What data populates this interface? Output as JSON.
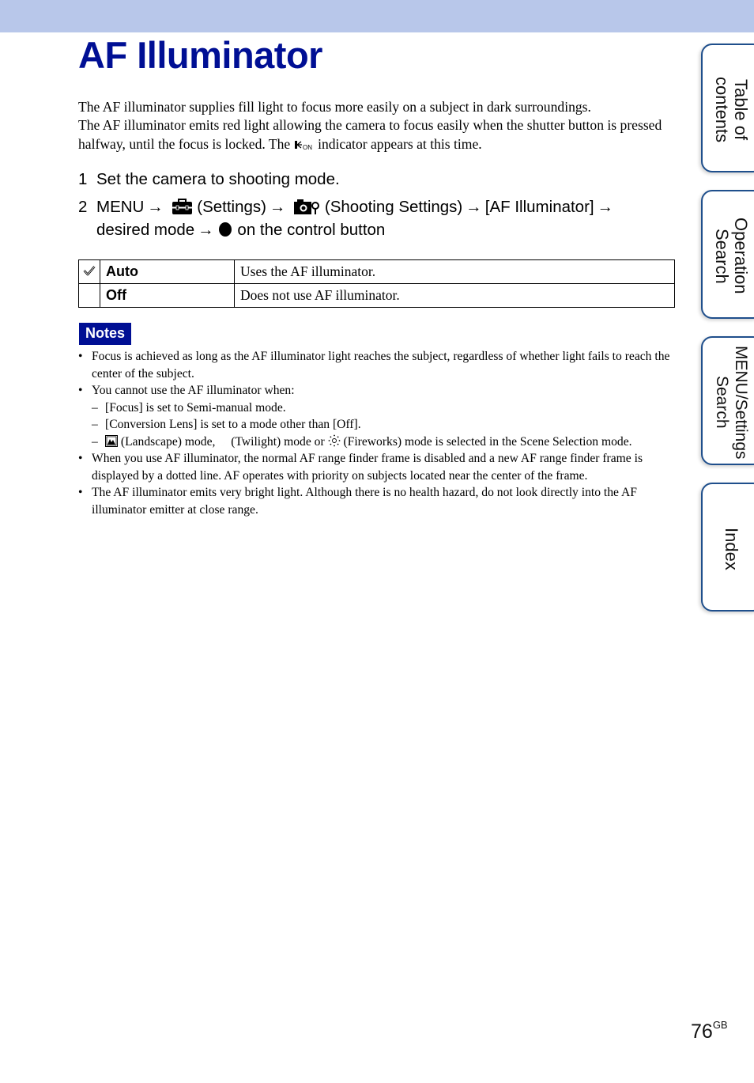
{
  "header": {
    "title": "AF Illuminator"
  },
  "intro": {
    "line1": "The AF illuminator supplies fill light to focus more easily on a subject in dark surroundings.",
    "line2_before_icon": "The AF illuminator emits red light allowing the camera to focus easily when the shutter button is pressed halfway, until the focus is locked. The",
    "indicator_icon": "af-illuminator-on-indicator-icon",
    "line2_after_icon": "indicator appears at this time."
  },
  "steps": [
    {
      "number": "1",
      "text": "Set the camera to shooting mode."
    },
    {
      "number": "2",
      "parts": {
        "menu": "MENU",
        "arrow": "→",
        "settings_icon": "toolbox-icon",
        "settings": "(Settings)",
        "shooting_icon": "camera-settings-icon",
        "shooting": "(Shooting Settings)",
        "item": "[AF Illuminator]",
        "desired": "desired mode",
        "button_icon": "filled-circle-icon",
        "control": "on the control button"
      }
    }
  ],
  "options": [
    {
      "default": true,
      "checkmark": "✓",
      "name": "Auto",
      "description": "Uses the AF illuminator."
    },
    {
      "default": false,
      "checkmark": "",
      "name": "Off",
      "description": "Does not use AF illuminator."
    }
  ],
  "notes": {
    "label": "Notes",
    "items": [
      {
        "text": "Focus is achieved as long as the AF illuminator light reaches the subject, regardless of whether light fails to reach the center of the subject."
      },
      {
        "text": "You cannot use the AF illuminator when:",
        "subitems": [
          "[Focus] is set to Semi-manual mode.",
          "[Conversion Lens] is set to a mode other than [Off]."
        ],
        "scene": {
          "landscape_icon": "landscape-icon",
          "landscape": "(Landscape) mode,",
          "twilight_icon": "twilight-moon-icon",
          "twilight": "(Twilight) mode or",
          "fireworks_icon": "fireworks-icon",
          "fireworks": "(Fireworks) mode is selected in the Scene Selection mode."
        }
      },
      {
        "text": "When you use AF illuminator, the normal AF range finder frame is disabled and a new AF range finder frame is displayed by a dotted line. AF operates with priority on subjects located near the center of the frame."
      },
      {
        "text": "The AF illuminator emits very bright light. Although there is no health hazard, do not look directly into the AF illuminator emitter at close range."
      }
    ]
  },
  "side_tabs": [
    {
      "label": "Table of\ncontents"
    },
    {
      "label": "Operation\nSearch"
    },
    {
      "label": "MENU/Settings\nSearch"
    },
    {
      "label": "Index"
    }
  ],
  "footer": {
    "page_number": "76",
    "suffix": "GB"
  },
  "colors": {
    "title": "#000f94",
    "band": "#b8c7ea",
    "notes_badge": "#000f94",
    "tab_border": "#1f4f8c"
  }
}
